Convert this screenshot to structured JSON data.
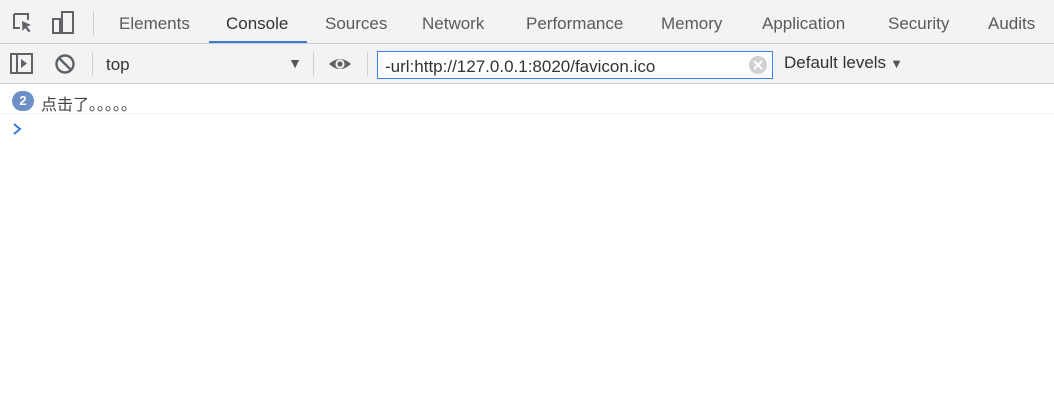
{
  "tabs": [
    {
      "label": "Elements",
      "selected": false
    },
    {
      "label": "Console",
      "selected": true
    },
    {
      "label": "Sources",
      "selected": false
    },
    {
      "label": "Network",
      "selected": false
    },
    {
      "label": "Performance",
      "selected": false
    },
    {
      "label": "Memory",
      "selected": false
    },
    {
      "label": "Application",
      "selected": false
    },
    {
      "label": "Security",
      "selected": false
    },
    {
      "label": "Audits",
      "selected": false
    }
  ],
  "toolbar_icons": [
    "inspect-element-icon",
    "device-toolbar-icon"
  ],
  "console_toolbar": {
    "sidebar_toggle_icon": "show-sidebar-icon",
    "clear_icon": "clear-console-icon",
    "context": "top",
    "eye_icon": "live-expression-icon",
    "filter_value": "-url:http://127.0.0.1:8020/favicon.ico",
    "filter_clear_icon": "clear-filter-icon",
    "levels_label": "Default levels"
  },
  "messages": [
    {
      "repeat_count": "2",
      "text": "点击了。。。。。"
    }
  ],
  "colors": {
    "accent": "#3879d9",
    "badge": "#6b8fc7",
    "toolbar_bg": "#f3f3f3"
  }
}
